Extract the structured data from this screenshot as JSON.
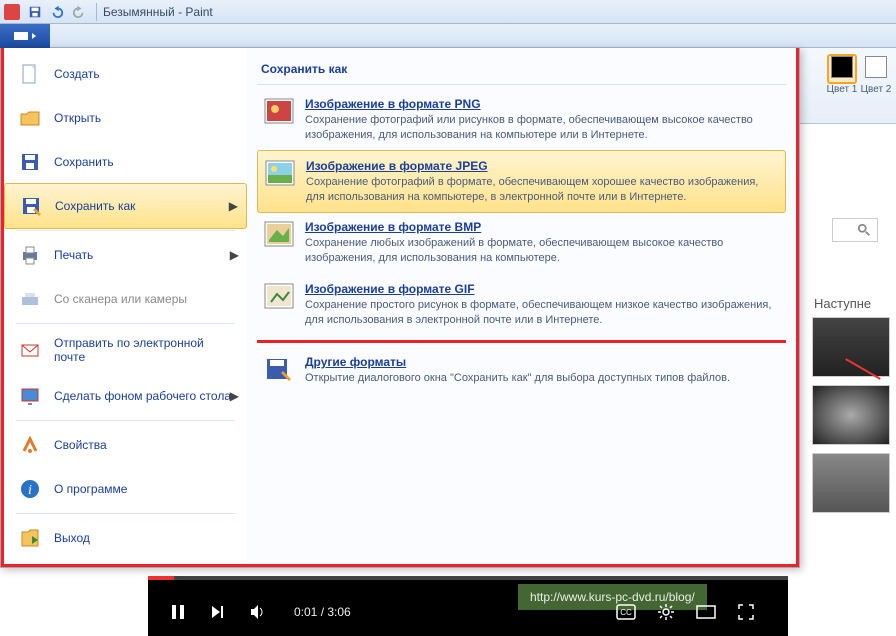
{
  "titlebar": {
    "title": "Безымянный - Paint"
  },
  "ribbon": {
    "colors": [
      {
        "name": "Цвет 1",
        "value": "#000000",
        "active": true
      },
      {
        "name": "Цвет 2",
        "value": "#ffffff",
        "active": false
      }
    ]
  },
  "filemenu": {
    "left": [
      {
        "id": "new",
        "label": "Создать",
        "disabled": false,
        "hasArrow": false
      },
      {
        "id": "open",
        "label": "Открыть",
        "disabled": false,
        "hasArrow": false
      },
      {
        "id": "save",
        "label": "Сохранить",
        "disabled": false,
        "hasArrow": false
      },
      {
        "id": "saveas",
        "label": "Сохранить как",
        "disabled": false,
        "hasArrow": true,
        "highlighted": true
      },
      {
        "id": "print",
        "label": "Печать",
        "disabled": false,
        "hasArrow": true
      },
      {
        "id": "scanner",
        "label": "Со сканера или камеры",
        "disabled": true,
        "hasArrow": false
      },
      {
        "id": "email",
        "label": "Отправить по электронной почте",
        "disabled": false,
        "hasArrow": false
      },
      {
        "id": "wallpaper",
        "label": "Сделать фоном рабочего стола",
        "disabled": false,
        "hasArrow": true
      },
      {
        "id": "properties",
        "label": "Свойства",
        "disabled": false,
        "hasArrow": false
      },
      {
        "id": "about",
        "label": "О программе",
        "disabled": false,
        "hasArrow": false
      },
      {
        "id": "exit",
        "label": "Выход",
        "disabled": false,
        "hasArrow": false
      }
    ],
    "submenu": {
      "title": "Сохранить как",
      "items": [
        {
          "id": "png",
          "title": "Изображение в формате PNG",
          "desc": "Сохранение фотографий или рисунков в формате, обеспечивающем высокое качество изображения, для использования на компьютере или в Интернете.",
          "highlighted": false
        },
        {
          "id": "jpeg",
          "title": "Изображение в формате JPEG",
          "desc": "Сохранение фотографий в формате, обеспечивающем хорошее качество изображения, для использования на компьютере, в электронной почте или в Интернете.",
          "highlighted": true
        },
        {
          "id": "bmp",
          "title": "Изображение в формате BMP",
          "desc": "Сохранение любых изображений в формате, обеспечивающем высокое качество изображения, для использования на компьютере.",
          "highlighted": false
        },
        {
          "id": "gif",
          "title": "Изображение в формате GIF",
          "desc": "Сохранение простого рисунок в формате, обеспечивающем низкое качество изображения, для использования в электронной почте или в Интернете.",
          "highlighted": false
        },
        {
          "id": "other",
          "title": "Другие форматы",
          "desc": "Открытие диалогового окна \"Сохранить как\" для выбора доступных типов файлов.",
          "highlighted": false
        }
      ]
    }
  },
  "sidebar": {
    "title": "Наступне"
  },
  "video": {
    "elapsed": "0:01",
    "total": "3:06",
    "overlay_url": "http://www.kurs-pc-dvd.ru/blog/"
  }
}
